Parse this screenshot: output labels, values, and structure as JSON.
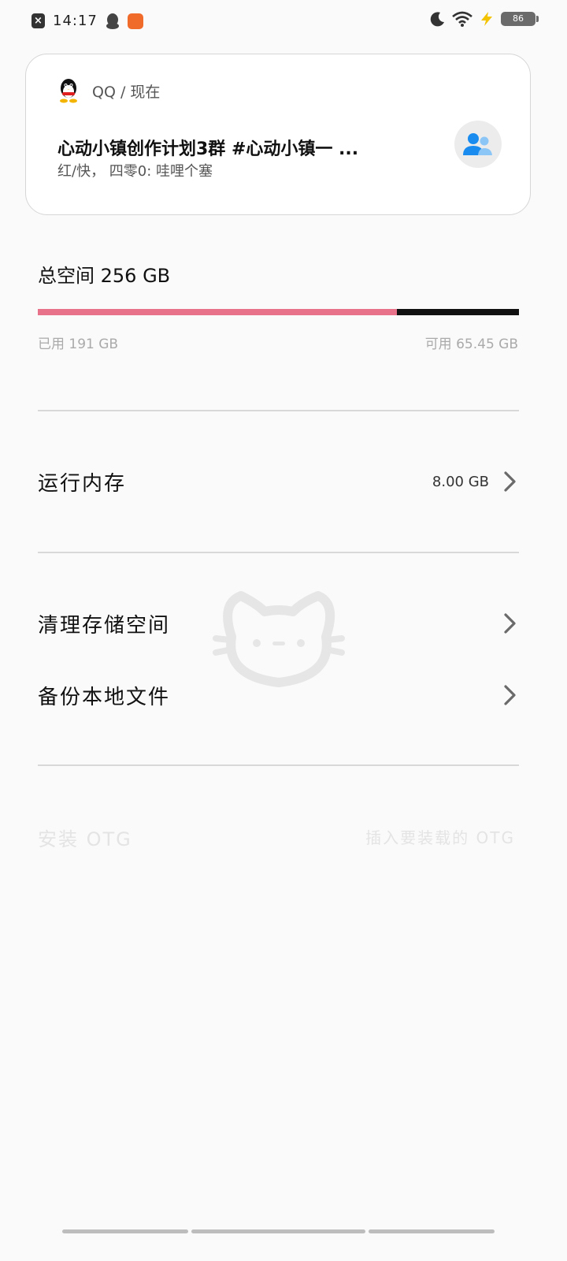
{
  "status_bar": {
    "time": "14:17",
    "battery": "86",
    "icons": [
      "close-app-icon",
      "qq-penguin-icon",
      "app-badge-icon",
      "moon-icon",
      "wifi-icon",
      "charging-icon",
      "battery-icon"
    ]
  },
  "notification": {
    "app": "QQ / 现在",
    "title": "心动小镇创作计划3群 #心动小镇一 ...",
    "body": "红/快， 四零0: 哇哩个塞",
    "icon": "qq-penguin-icon",
    "avatar_icon": "group-avatar-icon"
  },
  "storage": {
    "total_label": "总空间 256 GB",
    "used_label": "已用 191 GB",
    "available_label": "可用 65.45 GB",
    "used_fraction": 0.7461,
    "used_color": "#e8728a",
    "free_color": "#111111"
  },
  "menu": {
    "ram_label": "运行内存",
    "ram_value": "8.00 GB",
    "clean_label": "清理存储空间",
    "backup_label": "备份本地文件"
  },
  "otg": {
    "label": "安装 OTG",
    "hint": "插入要装载的 OTG"
  }
}
